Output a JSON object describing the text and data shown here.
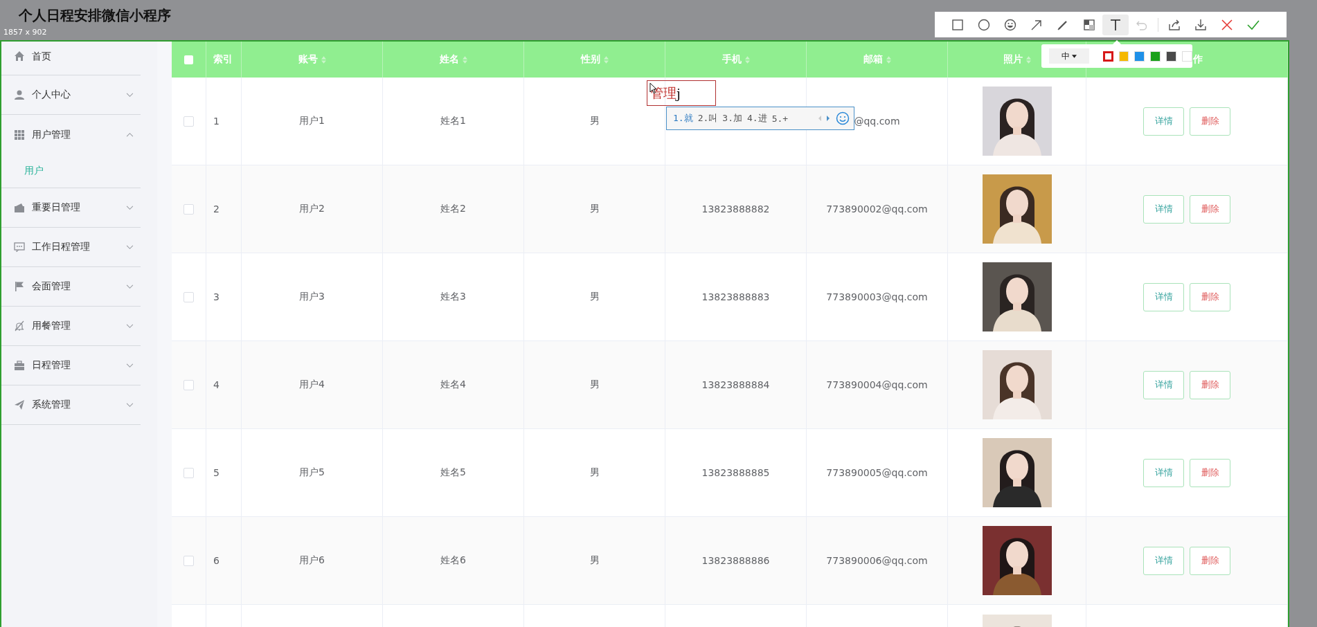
{
  "app_title": "个人日程安排微信小程序",
  "selection_size": "1857 x 902",
  "sidebar": {
    "items": [
      {
        "label": "首页",
        "kind": "home"
      },
      {
        "label": "个人中心",
        "kind": "user",
        "expanded": false
      },
      {
        "label": "用户管理",
        "kind": "grid",
        "expanded": true,
        "children": [
          {
            "label": "用户",
            "selected": true
          }
        ]
      },
      {
        "label": "重要日管理",
        "kind": "wallet",
        "expanded": false
      },
      {
        "label": "工作日程管理",
        "kind": "chat",
        "expanded": false
      },
      {
        "label": "会面管理",
        "kind": "flag",
        "expanded": false
      },
      {
        "label": "用餐管理",
        "kind": "bell",
        "expanded": false
      },
      {
        "label": "日程管理",
        "kind": "briefcase",
        "expanded": false
      },
      {
        "label": "系统管理",
        "kind": "plane",
        "expanded": false
      }
    ]
  },
  "table": {
    "all_checked": false,
    "columns": [
      {
        "label": "索引",
        "sortable": false
      },
      {
        "label": "账号",
        "sortable": true
      },
      {
        "label": "姓名",
        "sortable": true
      },
      {
        "label": "性别",
        "sortable": true
      },
      {
        "label": "手机",
        "sortable": true
      },
      {
        "label": "邮箱",
        "sortable": true
      },
      {
        "label": "照片",
        "sortable": true
      },
      {
        "label": "作",
        "sortable": false
      }
    ],
    "rows": [
      {
        "checked": false,
        "index": "1",
        "account": "用户1",
        "name": "姓名1",
        "gender": "男",
        "email": "@qq.com",
        "buttons": [
          {
            "label": "详情",
            "kind": "detail"
          },
          {
            "label": "删除",
            "kind": "delete"
          }
        ]
      },
      {
        "checked": false,
        "index": "2",
        "account": "用户2",
        "name": "姓名2",
        "gender": "男",
        "phone": "13823888882",
        "email": "773890002@qq.com",
        "buttons": [
          {
            "label": "详情",
            "kind": "detail"
          },
          {
            "label": "删除",
            "kind": "delete"
          }
        ]
      },
      {
        "checked": false,
        "index": "3",
        "account": "用户3",
        "name": "姓名3",
        "gender": "男",
        "phone": "13823888883",
        "email": "773890003@qq.com",
        "buttons": [
          {
            "label": "详情",
            "kind": "detail"
          },
          {
            "label": "删除",
            "kind": "delete"
          }
        ]
      },
      {
        "checked": false,
        "index": "4",
        "account": "用户4",
        "name": "姓名4",
        "gender": "男",
        "phone": "13823888884",
        "email": "773890004@qq.com",
        "buttons": [
          {
            "label": "详情",
            "kind": "detail"
          },
          {
            "label": "删除",
            "kind": "delete"
          }
        ]
      },
      {
        "checked": false,
        "index": "5",
        "account": "用户5",
        "name": "姓名5",
        "gender": "男",
        "phone": "13823888885",
        "email": "773890005@qq.com",
        "buttons": [
          {
            "label": "详情",
            "kind": "detail"
          },
          {
            "label": "删除",
            "kind": "delete"
          }
        ]
      },
      {
        "checked": false,
        "index": "6",
        "account": "用户6",
        "name": "姓名6",
        "gender": "男",
        "phone": "13823888886",
        "email": "773890006@qq.com",
        "buttons": [
          {
            "label": "详情",
            "kind": "detail"
          },
          {
            "label": "删除",
            "kind": "delete"
          }
        ]
      }
    ]
  },
  "toolbar": {
    "tools": [
      {
        "kind": "rectangle",
        "selected": false,
        "disabled": false
      },
      {
        "kind": "ellipse",
        "selected": false,
        "disabled": false
      },
      {
        "kind": "emoji",
        "selected": false,
        "disabled": false
      },
      {
        "kind": "arrow",
        "selected": false,
        "disabled": false
      },
      {
        "kind": "pen",
        "selected": false,
        "disabled": false
      },
      {
        "kind": "mosaic",
        "selected": false,
        "disabled": false
      },
      {
        "kind": "text",
        "selected": true,
        "disabled": false
      },
      {
        "kind": "undo",
        "selected": false,
        "disabled": true
      },
      {
        "kind": "share",
        "selected": false,
        "disabled": false
      },
      {
        "kind": "download",
        "selected": false,
        "disabled": false
      },
      {
        "kind": "cancel",
        "selected": false,
        "disabled": false
      },
      {
        "kind": "confirm",
        "selected": false,
        "disabled": false
      }
    ]
  },
  "text_style": {
    "size": "中",
    "swatches": [
      {
        "color": "#d71818",
        "selected": true
      },
      {
        "color": "#f5b800",
        "selected": false
      },
      {
        "color": "#1e90e8",
        "selected": false
      },
      {
        "color": "#1aa01a",
        "selected": false
      },
      {
        "color": "#4a4a4a",
        "selected": false
      },
      {
        "color": "#ffffff",
        "selected": false
      }
    ]
  },
  "annotation": {
    "text": "管理",
    "composing": "j"
  },
  "ime": {
    "candidates": [
      {
        "label": "1.就",
        "selected": true
      },
      {
        "label": "2.叫",
        "selected": false
      },
      {
        "label": "3.加",
        "selected": false
      },
      {
        "label": "4.进",
        "selected": false
      },
      {
        "label": "5.+",
        "selected": false
      }
    ]
  }
}
